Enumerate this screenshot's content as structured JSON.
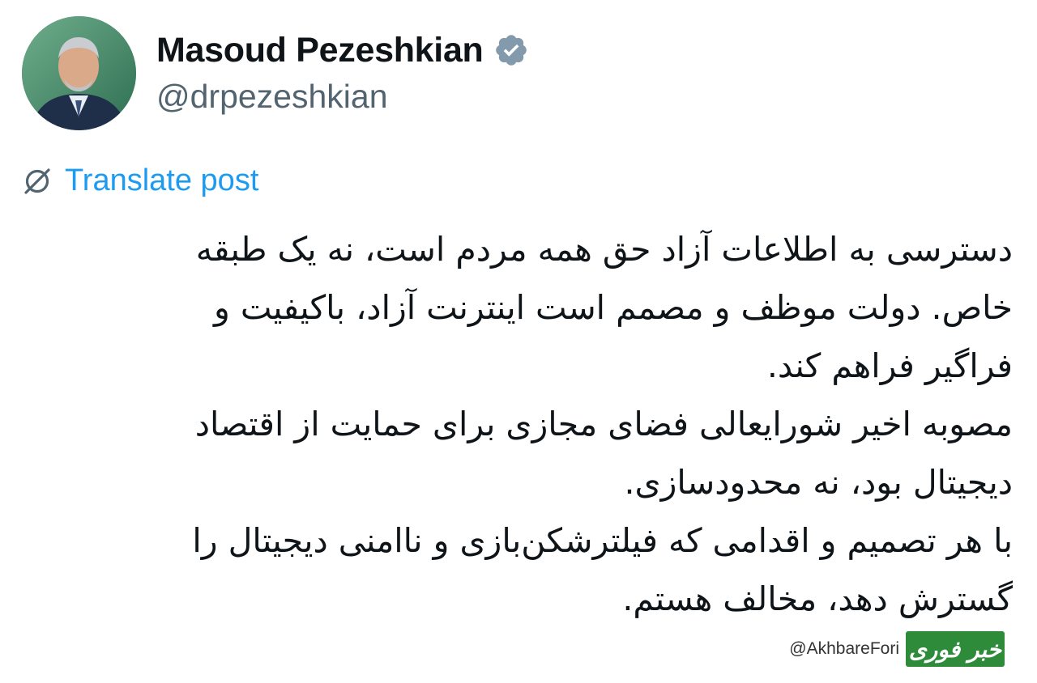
{
  "author": {
    "display_name": "Masoud Pezeshkian",
    "handle": "@drpezeshkian",
    "verified": true,
    "verified_badge_color": "#829aab"
  },
  "translate": {
    "label": "Translate post",
    "color": "#1d9bf0"
  },
  "post": {
    "lines": [
      "دسترسی به اطلاعات آزاد حق همه مردم است، نه یک طبقه",
      "خاص. دولت موظف و مصمم است اینترنت آزاد، باکیفیت و",
      "فراگیر فراهم کند.",
      "مصوبه اخیر شورایعالی فضای مجازی برای حمایت از اقتصاد",
      "دیجیتال بود، نه محدودسازی.",
      "با هر تصمیم و اقدامی که فیلترشکن‌بازی و ناامنی دیجیتال را",
      "گسترش دهد، مخالف هستم."
    ]
  },
  "watermark": {
    "handle": "@AkhbareFori",
    "logo_text": "خبر فوری",
    "logo_color": "#2e8b3a"
  }
}
